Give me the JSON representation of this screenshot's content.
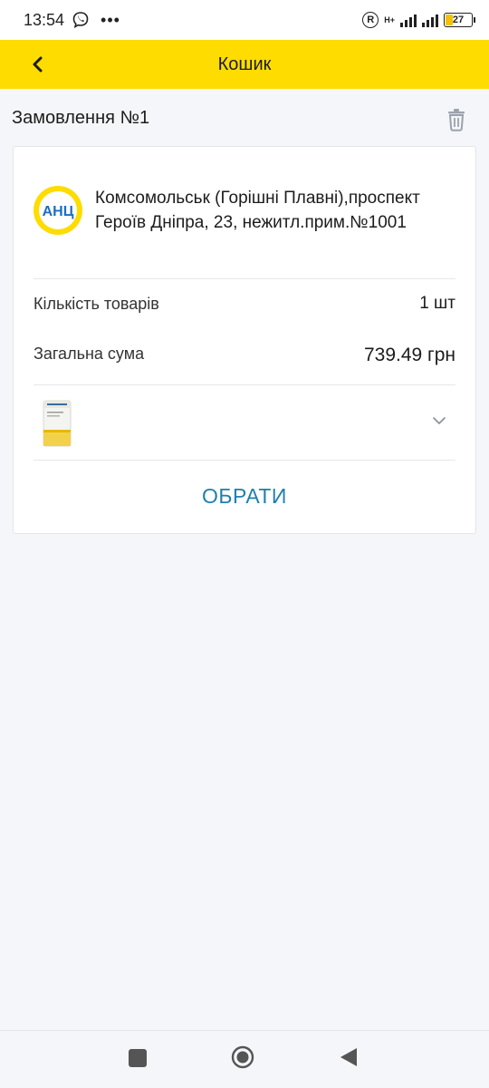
{
  "status_bar": {
    "time": "13:54",
    "network_label": "H+",
    "battery_level": "27",
    "battery_color": "#f3c300"
  },
  "header": {
    "title": "Кошик",
    "back_icon": "chevron-left-icon",
    "background": "#fedc00"
  },
  "order": {
    "title": "Замовлення №1",
    "delete_icon": "trash-icon",
    "pharmacy": {
      "logo_text": "АНЦ",
      "address": "Комсомольськ (Горішні Плавні),проспект Героїв Дніпра, 23, нежитл.прим.№1001"
    },
    "items_count_label": "Кількість товарів",
    "items_count_value": "1 шт",
    "total_label": "Загальна сума",
    "total_value": "739.49 грн",
    "expand_icon": "chevron-down-icon",
    "choose_label": "ОБРАТИ",
    "accent_color": "#1f7fb0"
  },
  "nav": {
    "recent_icon": "square-icon",
    "home_icon": "circle-home-icon",
    "back_icon": "triangle-back-icon"
  }
}
